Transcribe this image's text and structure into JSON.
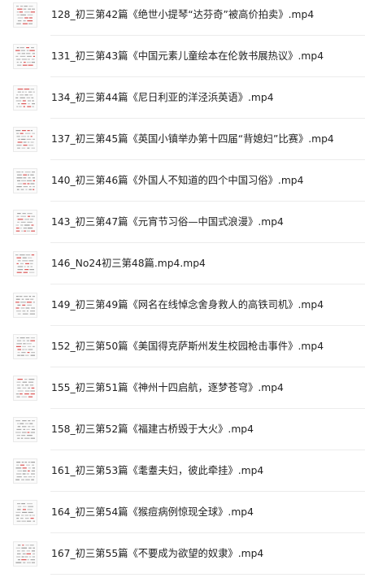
{
  "file_list": {
    "items": [
      {
        "name": "128_初三第42篇《绝世小提琴“达芬奇”被高价拍卖》.mp4",
        "icon": "document-thumbnail-icon"
      },
      {
        "name": "131_初三第43篇《中国元素儿童绘本在伦敦书展热议》.mp4",
        "icon": "document-thumbnail-icon"
      },
      {
        "name": "134_初三第44篇《尼日利亚的洋泾浜英语》.mp4",
        "icon": "document-thumbnail-icon"
      },
      {
        "name": "137_初三第45篇《英国小镇举办第十四届“背媳妇”比赛》.mp4",
        "icon": "document-thumbnail-icon"
      },
      {
        "name": "140_初三第46篇《外国人不知道的四个中国习俗》.mp4",
        "icon": "document-thumbnail-icon"
      },
      {
        "name": "143_初三第47篇《元宵节习俗—中国式浪漫》.mp4",
        "icon": "document-thumbnail-icon"
      },
      {
        "name": "146_No24初三第48篇.mp4.mp4",
        "icon": "document-thumbnail-icon"
      },
      {
        "name": "149_初三第49篇《网名在线悼念舍身救人的高铁司机》.mp4",
        "icon": "document-thumbnail-icon"
      },
      {
        "name": "152_初三第50篇《美国得克萨斯州发生校园枪击事件》.mp4",
        "icon": "document-thumbnail-icon"
      },
      {
        "name": "155_初三第51篇《神州十四启航，逐梦苍穹》.mp4",
        "icon": "document-thumbnail-icon"
      },
      {
        "name": "158_初三第52篇《福建古桥毁于大火》.mp4",
        "icon": "document-thumbnail-icon"
      },
      {
        "name": "161_初三第53篇《耄耋夫妇，彼此牵挂》.mp4",
        "icon": "document-thumbnail-icon"
      },
      {
        "name": "164_初三第54篇《猴痘病例惊现全球》.mp4",
        "icon": "document-thumbnail-icon"
      },
      {
        "name": "167_初三第55篇《不要成为欲望的奴隶》.mp4",
        "icon": "document-thumbnail-icon"
      }
    ]
  },
  "colors": {
    "background": "#ffffff",
    "text": "#222222",
    "divider": "#ececec",
    "thumb_accent": "#d63a3a"
  }
}
